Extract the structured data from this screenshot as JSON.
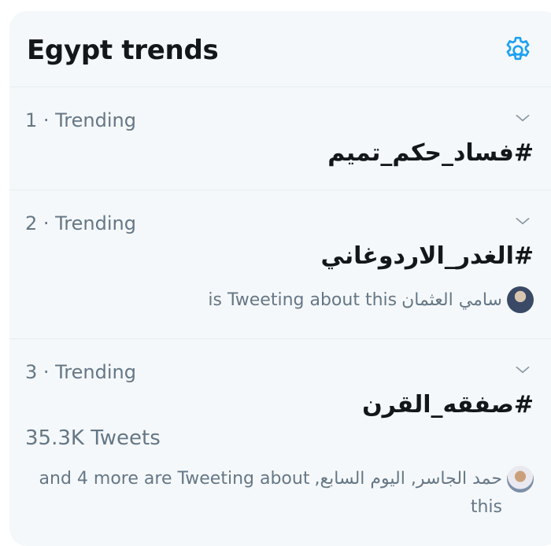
{
  "header": {
    "title": "Egypt trends",
    "settings_icon": "gear-icon"
  },
  "colors": {
    "accent": "#1da1f2",
    "panel_bg": "#f5f8fa",
    "text_primary": "#14171a",
    "text_secondary": "#657786"
  },
  "trends": [
    {
      "meta": "1 · Trending",
      "hashtag": "#فساد_حكم_تميم"
    },
    {
      "meta": "2 · Trending",
      "hashtag": "#الغدر_الاردوغاني",
      "tweeting_names": "سامي العثمان",
      "tweeting_text": "is Tweeting about this"
    },
    {
      "meta": "3 · Trending",
      "hashtag": "#صفقه_القرن",
      "tweet_count": "35.3K Tweets",
      "tweeting_names": "حمد الجاسر, اليوم السابع,",
      "tweeting_text": "and 4 more are Tweeting about",
      "tweeting_text_wrap": "this"
    }
  ]
}
